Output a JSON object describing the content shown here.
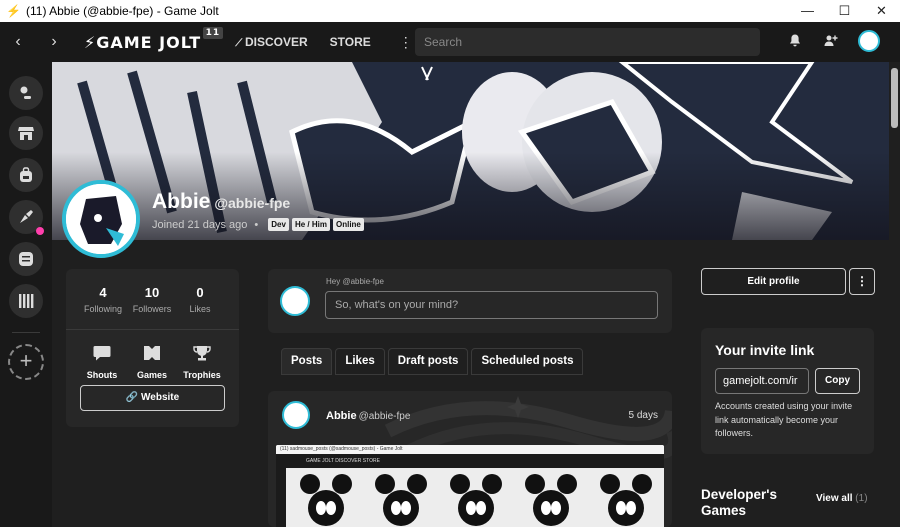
{
  "window": {
    "title": "(11) Abbie (@abbie-fpe) - Game Jolt",
    "minimize": "—",
    "maximize": "☐",
    "close": "✕"
  },
  "nav": {
    "back": "‹",
    "forward": "›",
    "logo": "⚡GAME JOLT",
    "notification_count": "11",
    "discover": "DISCOVER",
    "store": "STORE",
    "more": "⋮",
    "search_placeholder": "Search"
  },
  "profile": {
    "name": "Abbie",
    "handle": "@abbie-fpe",
    "joined": "Joined 21 days ago",
    "separator": "•",
    "tags": [
      "Dev",
      "He / Him",
      "Online"
    ]
  },
  "stats": {
    "following": {
      "value": "4",
      "label": "Following"
    },
    "followers": {
      "value": "10",
      "label": "Followers"
    },
    "likes": {
      "value": "0",
      "label": "Likes"
    },
    "shortcuts": {
      "shouts": "Shouts",
      "games": "Games",
      "trophies": "Trophies"
    },
    "website": "Website"
  },
  "composer": {
    "greeting": "Hey @abbie-fpe",
    "placeholder": "So, what's on your mind?"
  },
  "tabs": [
    "Posts",
    "Likes",
    "Draft posts",
    "Scheduled posts"
  ],
  "post": {
    "author": "Abbie",
    "handle": "@abbie-fpe",
    "time": "5 days",
    "shot_title": "(11) sadmouse_posts (@sadmouse_posts) - Game Jolt",
    "shot_nav": "GAME JOLT   DISCOVER   STORE"
  },
  "actions": {
    "edit_profile": "Edit profile",
    "more": "⋮"
  },
  "invite": {
    "title": "Your invite link",
    "link": "gamejolt.com/ir",
    "copy": "Copy",
    "description": "Accounts created using your invite link automatically become your followers."
  },
  "developer_games": {
    "title": "Developer's Games",
    "view_all": "View all",
    "count": "(1)"
  },
  "colors": {
    "accent": "#2fbcd6",
    "notify": "#ff3fac",
    "background": "#1f1f1f",
    "card": "#272727"
  }
}
